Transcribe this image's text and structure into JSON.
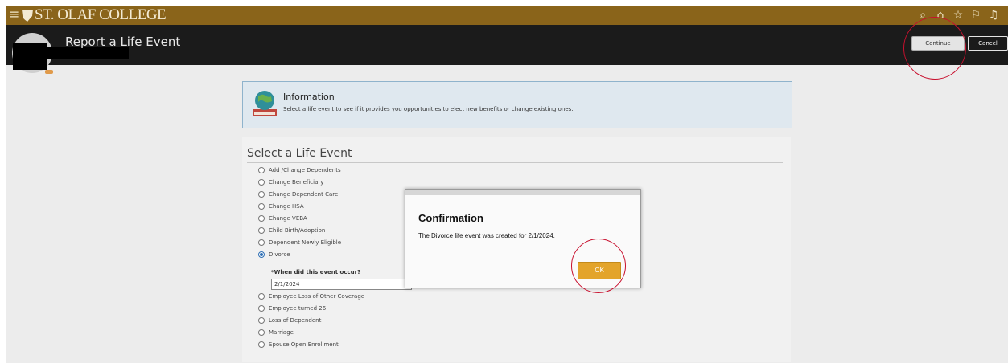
{
  "topbar": {
    "brand": "ST. OLAF COLLEGE",
    "icons": [
      "hamburger-icon",
      "search-icon",
      "home-icon",
      "favorites-star-icon",
      "flag-icon",
      "bell-icon"
    ],
    "colors": {
      "bar": "#8a641a",
      "header": "#1b1b1b"
    }
  },
  "header": {
    "title": "Report a Life Event",
    "continue_label": "Continue",
    "cancel_label": "Cancel"
  },
  "info": {
    "title": "Information",
    "description": "Select a life event to see if it provides you opportunities to elect new benefits or change existing ones."
  },
  "events": {
    "title": "Select a Life Event",
    "options": [
      {
        "label": "Add /Change Dependents",
        "selected": false
      },
      {
        "label": "Change Beneficiary",
        "selected": false
      },
      {
        "label": "Change Dependent Care",
        "selected": false
      },
      {
        "label": "Change HSA",
        "selected": false
      },
      {
        "label": "Change VEBA",
        "selected": false
      },
      {
        "label": "Child Birth/Adoption",
        "selected": false
      },
      {
        "label": "Dependent Newly Eligible",
        "selected": false
      },
      {
        "label": "Divorce",
        "selected": true
      },
      {
        "label": "Employee Loss of Other Coverage",
        "selected": false
      },
      {
        "label": "Employee turned 26",
        "selected": false
      },
      {
        "label": "Loss of Dependent",
        "selected": false
      },
      {
        "label": "Marriage",
        "selected": false
      },
      {
        "label": "Spouse Open Enrollment",
        "selected": false
      }
    ],
    "question": "*When did this event occur?",
    "date_value": "2/1/2024"
  },
  "modal": {
    "title": "Confirmation",
    "message": "The Divorce life event was created for 2/1/2024.",
    "ok_label": "OK",
    "accent": "#e3a42b"
  }
}
